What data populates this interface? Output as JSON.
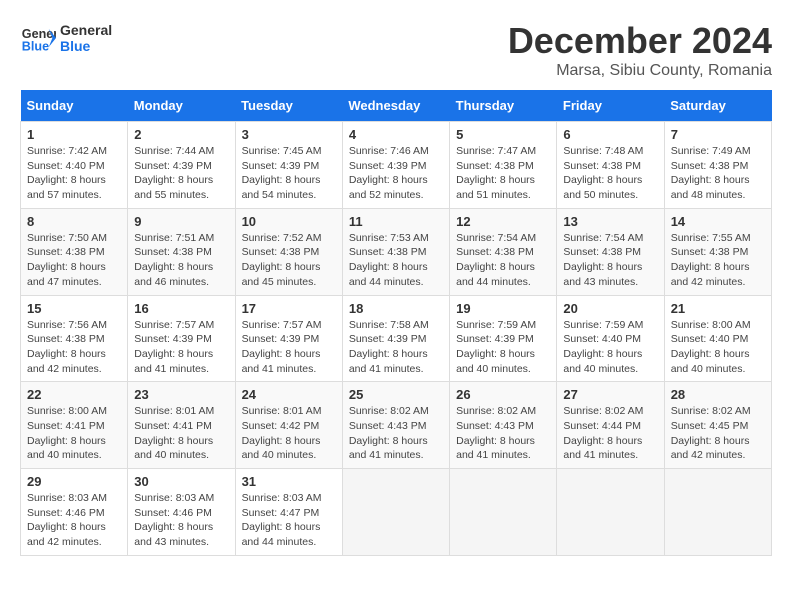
{
  "header": {
    "logo_line1": "General",
    "logo_line2": "Blue",
    "title": "December 2024",
    "subtitle": "Marsa, Sibiu County, Romania"
  },
  "days_of_week": [
    "Sunday",
    "Monday",
    "Tuesday",
    "Wednesday",
    "Thursday",
    "Friday",
    "Saturday"
  ],
  "weeks": [
    [
      {
        "day": "1",
        "sunrise": "7:42 AM",
        "sunset": "4:40 PM",
        "daylight": "8 hours and 57 minutes."
      },
      {
        "day": "2",
        "sunrise": "7:44 AM",
        "sunset": "4:39 PM",
        "daylight": "8 hours and 55 minutes."
      },
      {
        "day": "3",
        "sunrise": "7:45 AM",
        "sunset": "4:39 PM",
        "daylight": "8 hours and 54 minutes."
      },
      {
        "day": "4",
        "sunrise": "7:46 AM",
        "sunset": "4:39 PM",
        "daylight": "8 hours and 52 minutes."
      },
      {
        "day": "5",
        "sunrise": "7:47 AM",
        "sunset": "4:38 PM",
        "daylight": "8 hours and 51 minutes."
      },
      {
        "day": "6",
        "sunrise": "7:48 AM",
        "sunset": "4:38 PM",
        "daylight": "8 hours and 50 minutes."
      },
      {
        "day": "7",
        "sunrise": "7:49 AM",
        "sunset": "4:38 PM",
        "daylight": "8 hours and 48 minutes."
      }
    ],
    [
      {
        "day": "8",
        "sunrise": "7:50 AM",
        "sunset": "4:38 PM",
        "daylight": "8 hours and 47 minutes."
      },
      {
        "day": "9",
        "sunrise": "7:51 AM",
        "sunset": "4:38 PM",
        "daylight": "8 hours and 46 minutes."
      },
      {
        "day": "10",
        "sunrise": "7:52 AM",
        "sunset": "4:38 PM",
        "daylight": "8 hours and 45 minutes."
      },
      {
        "day": "11",
        "sunrise": "7:53 AM",
        "sunset": "4:38 PM",
        "daylight": "8 hours and 44 minutes."
      },
      {
        "day": "12",
        "sunrise": "7:54 AM",
        "sunset": "4:38 PM",
        "daylight": "8 hours and 44 minutes."
      },
      {
        "day": "13",
        "sunrise": "7:54 AM",
        "sunset": "4:38 PM",
        "daylight": "8 hours and 43 minutes."
      },
      {
        "day": "14",
        "sunrise": "7:55 AM",
        "sunset": "4:38 PM",
        "daylight": "8 hours and 42 minutes."
      }
    ],
    [
      {
        "day": "15",
        "sunrise": "7:56 AM",
        "sunset": "4:38 PM",
        "daylight": "8 hours and 42 minutes."
      },
      {
        "day": "16",
        "sunrise": "7:57 AM",
        "sunset": "4:39 PM",
        "daylight": "8 hours and 41 minutes."
      },
      {
        "day": "17",
        "sunrise": "7:57 AM",
        "sunset": "4:39 PM",
        "daylight": "8 hours and 41 minutes."
      },
      {
        "day": "18",
        "sunrise": "7:58 AM",
        "sunset": "4:39 PM",
        "daylight": "8 hours and 41 minutes."
      },
      {
        "day": "19",
        "sunrise": "7:59 AM",
        "sunset": "4:39 PM",
        "daylight": "8 hours and 40 minutes."
      },
      {
        "day": "20",
        "sunrise": "7:59 AM",
        "sunset": "4:40 PM",
        "daylight": "8 hours and 40 minutes."
      },
      {
        "day": "21",
        "sunrise": "8:00 AM",
        "sunset": "4:40 PM",
        "daylight": "8 hours and 40 minutes."
      }
    ],
    [
      {
        "day": "22",
        "sunrise": "8:00 AM",
        "sunset": "4:41 PM",
        "daylight": "8 hours and 40 minutes."
      },
      {
        "day": "23",
        "sunrise": "8:01 AM",
        "sunset": "4:41 PM",
        "daylight": "8 hours and 40 minutes."
      },
      {
        "day": "24",
        "sunrise": "8:01 AM",
        "sunset": "4:42 PM",
        "daylight": "8 hours and 40 minutes."
      },
      {
        "day": "25",
        "sunrise": "8:02 AM",
        "sunset": "4:43 PM",
        "daylight": "8 hours and 41 minutes."
      },
      {
        "day": "26",
        "sunrise": "8:02 AM",
        "sunset": "4:43 PM",
        "daylight": "8 hours and 41 minutes."
      },
      {
        "day": "27",
        "sunrise": "8:02 AM",
        "sunset": "4:44 PM",
        "daylight": "8 hours and 41 minutes."
      },
      {
        "day": "28",
        "sunrise": "8:02 AM",
        "sunset": "4:45 PM",
        "daylight": "8 hours and 42 minutes."
      }
    ],
    [
      {
        "day": "29",
        "sunrise": "8:03 AM",
        "sunset": "4:46 PM",
        "daylight": "8 hours and 42 minutes."
      },
      {
        "day": "30",
        "sunrise": "8:03 AM",
        "sunset": "4:46 PM",
        "daylight": "8 hours and 43 minutes."
      },
      {
        "day": "31",
        "sunrise": "8:03 AM",
        "sunset": "4:47 PM",
        "daylight": "8 hours and 44 minutes."
      },
      null,
      null,
      null,
      null
    ]
  ]
}
